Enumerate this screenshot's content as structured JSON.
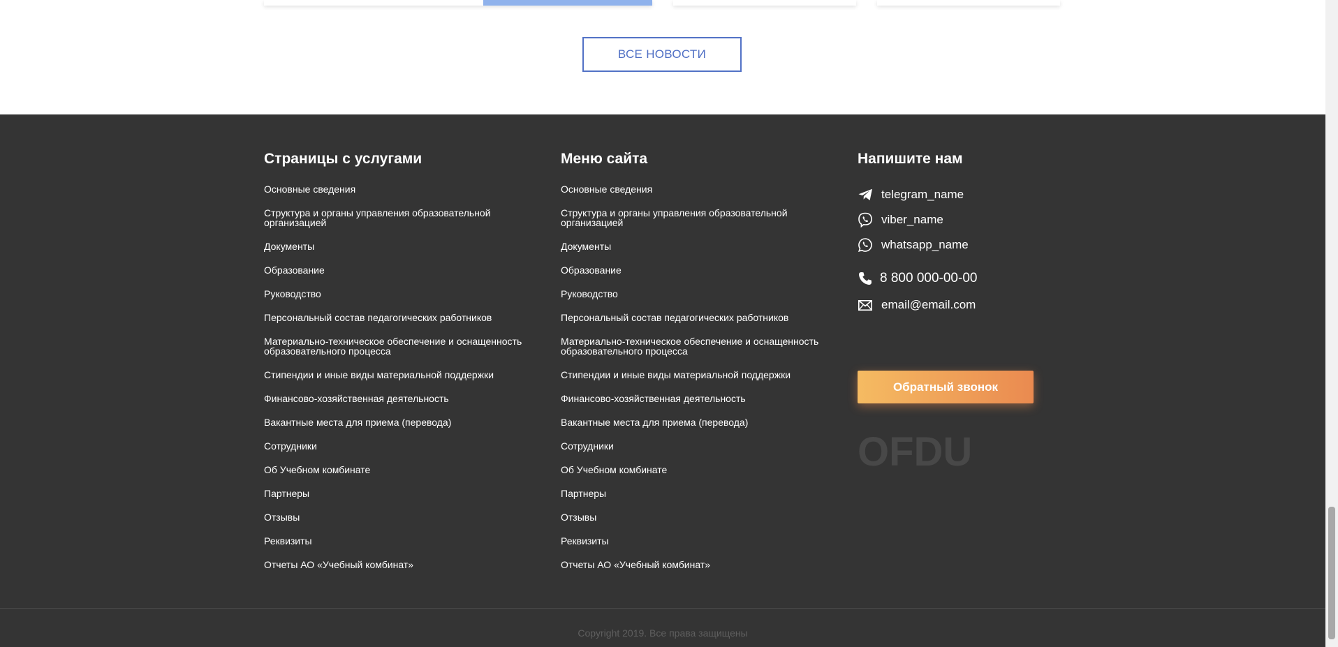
{
  "news": {
    "all_news_label": "ВСЕ НОВОСТИ"
  },
  "footer": {
    "services": {
      "title": "Страницы с услугами",
      "links": [
        "Основные сведения",
        "Структура и органы управления образовательной организацией",
        "Документы",
        "Образование",
        "Руководство",
        "Персональный состав педагогических работников",
        "Материально-техническое обеспечение и оснащенность образовательного процесса",
        "Стипендии и иные виды материальной поддержки",
        "Финансово-хозяйственная деятельность",
        "Вакантные места для приема (перевода)",
        "Сотрудники",
        "Об Учебном комбинате",
        "Партнеры",
        "Отзывы",
        "Реквизиты",
        "Отчеты АО «Учебный комбинат»"
      ]
    },
    "menu": {
      "title": "Меню сайта",
      "links": [
        "Основные сведения",
        "Структура и органы управления образовательной организацией",
        "Документы",
        "Образование",
        "Руководство",
        "Персональный состав педагогических работников",
        "Материально-техническое обеспечение и оснащенность образовательного процесса",
        "Стипендии и иные виды материальной поддержки",
        "Финансово-хозяйственная деятельность",
        "Вакантные места для приема (перевода)",
        "Сотрудники",
        "Об Учебном комбинате",
        "Партнеры",
        "Отзывы",
        "Реквизиты",
        "Отчеты АО «Учебный комбинат»"
      ]
    },
    "contact": {
      "title": "Напишите нам",
      "telegram": "telegram_name",
      "viber": "viber_name",
      "whatsapp": "whatsapp_name",
      "phone": "8 800 000-00-00",
      "email": "email@email.com",
      "callback_label": "Обратный звонок",
      "logo_text": "OFDU"
    },
    "copyright": "Copyright 2019. Все права защищены"
  },
  "icons": {
    "telegram": "telegram-icon",
    "viber": "viber-icon",
    "whatsapp": "whatsapp-icon",
    "phone": "phone-icon",
    "email": "envelope-icon"
  },
  "colors": {
    "footer_bg": "#343434",
    "accent_blue": "#5272c6",
    "callback_gradient_start": "#f5bb62",
    "callback_gradient_end": "#ea8a50"
  }
}
